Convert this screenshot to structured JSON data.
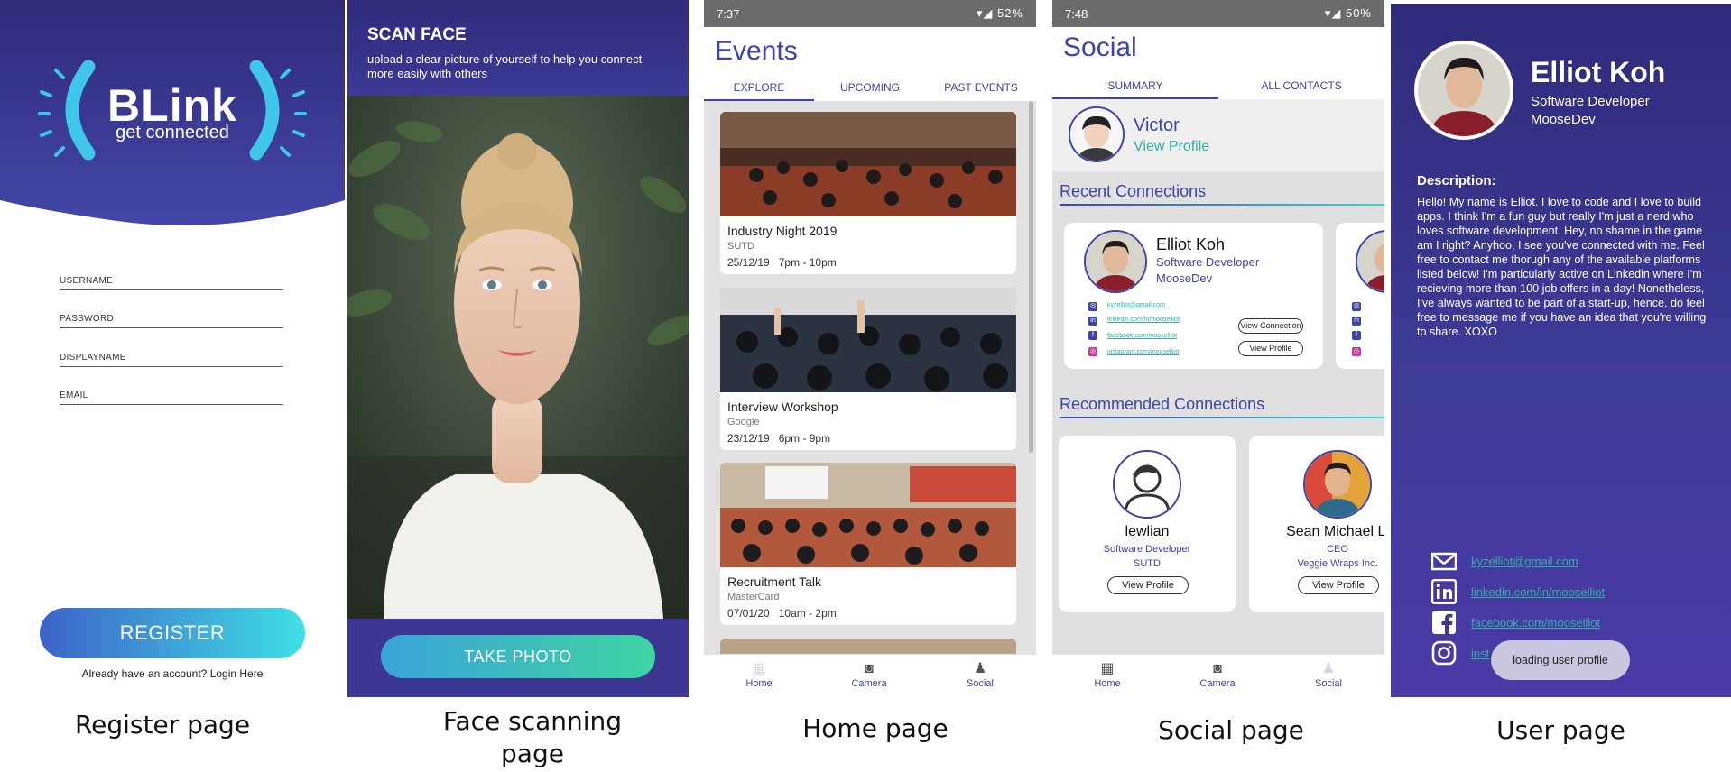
{
  "captions": [
    "Register page",
    "Face scanning page",
    "Home page",
    "Social page",
    "User page"
  ],
  "register": {
    "logo_title": "BLink",
    "logo_subtitle": "get connected",
    "fields": [
      "USERNAME",
      "PASSWORD",
      "DISPLAYNAME",
      "EMAIL"
    ],
    "register_button": "REGISTER",
    "login_text": "Already have an account? Login Here",
    "colors": {
      "hero": "#3d3a95",
      "accent": "#3fd4e6"
    }
  },
  "face": {
    "title": "SCAN FACE",
    "subtitle": "upload a clear picture of yourself to help you connect more easily with others",
    "take_photo_button": "TAKE PHOTO"
  },
  "home": {
    "status_time": "7:37",
    "status_battery": "52%",
    "title": "Events",
    "tabs": [
      "EXPLORE",
      "UPCOMING",
      "PAST EVENTS"
    ],
    "events": [
      {
        "name": "Industry Night 2019",
        "org": "SUTD",
        "date": "25/12/19",
        "time": "7pm - 10pm"
      },
      {
        "name": "Interview Workshop",
        "org": "Google",
        "date": "23/12/19",
        "time": "6pm - 9pm"
      },
      {
        "name": "Recruitment Talk",
        "org": "MasterCard",
        "date": "07/01/20",
        "time": "10am - 2pm"
      }
    ],
    "nav": [
      "Home",
      "Camera",
      "Social"
    ]
  },
  "social": {
    "status_time": "7:48",
    "status_battery": "50%",
    "title": "Social",
    "tabs": [
      "SUMMARY",
      "ALL CONTACTS"
    ],
    "me": {
      "name": "Victor",
      "link": "View Profile"
    },
    "recent_title": "Recent Connections",
    "recent": {
      "name": "Elliot Koh",
      "role": "Software Developer",
      "org": "MooseDev",
      "links": [
        "kyzelliot@gmail.com",
        "linkedin.com/in/mooselliot",
        "facebook.com/mooselliot",
        "instagram.com/mooselliot"
      ],
      "buttons": [
        "View Connection",
        "View Profile"
      ]
    },
    "recommended_title": "Recommended Connections",
    "recommended": [
      {
        "name": "lewlian",
        "role": "Software Developer",
        "org": "SUTD",
        "button": "View Profile"
      },
      {
        "name": "Sean Michael Li",
        "role": "CEO",
        "org": "Veggie Wraps Inc.",
        "button": "View Profile"
      }
    ],
    "nav": [
      "Home",
      "Camera",
      "Social"
    ]
  },
  "user": {
    "name": "Elliot Koh",
    "role": "Software Developer",
    "org": "MooseDev",
    "desc_heading": "Description:",
    "description": "Hello! My name is Elliot. I love to code and I love to build apps. I think I'm a fun guy but really I'm just a nerd who loves software development. Hey, no shame in the game am I right? Anyhoo, I see you've connected with me. Feel free to contact me thorugh any of the available platforms listed below! I'm particularly active on Linkedin where I'm recieving more than 100 job offers in a day! Nonetheless, I've always wanted to be part of a start-up, hence, do feel free to message me if you have an idea that you're willing to share. XOXO",
    "contacts": [
      "kyzelliot@gmail.com",
      "linkedin.com/in/mooselliot",
      "facebook.com/mooselliot",
      "inst"
    ],
    "toast": "loading user profile"
  }
}
